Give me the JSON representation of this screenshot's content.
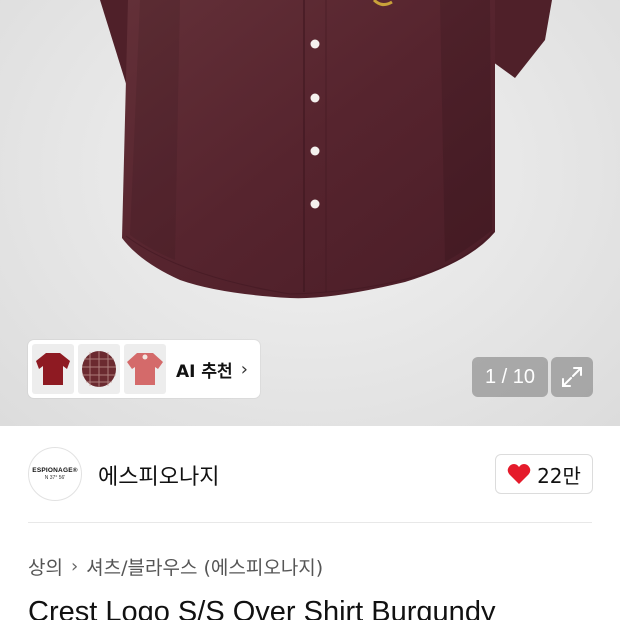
{
  "gallery": {
    "counter": "1 / 10",
    "ai_recommend_label": "AI 추천",
    "chevron": "›",
    "thumbnails": [
      {
        "icon": "burgundy-shirt-thumb",
        "color": "#8e1a22"
      },
      {
        "icon": "plaid-shirt-thumb",
        "color": "#6b2a30"
      },
      {
        "icon": "pink-shirt-thumb",
        "color": "#d46a6a"
      }
    ],
    "expand_icon": "expand-icon"
  },
  "brand": {
    "logo_line1": "ESPIONAGE®",
    "logo_line2": "N 37° 56'",
    "name": "에스피오나지",
    "like_count": "22만",
    "like_color": "#e51b2b"
  },
  "breadcrumb": {
    "category": "상의",
    "separator": "›",
    "subcategory": "셔츠/블라우스 (에스피오나지)"
  },
  "product": {
    "title": "Crest Logo S/S Over Shirt Burgundy",
    "shirt_color": "#5a2530"
  }
}
